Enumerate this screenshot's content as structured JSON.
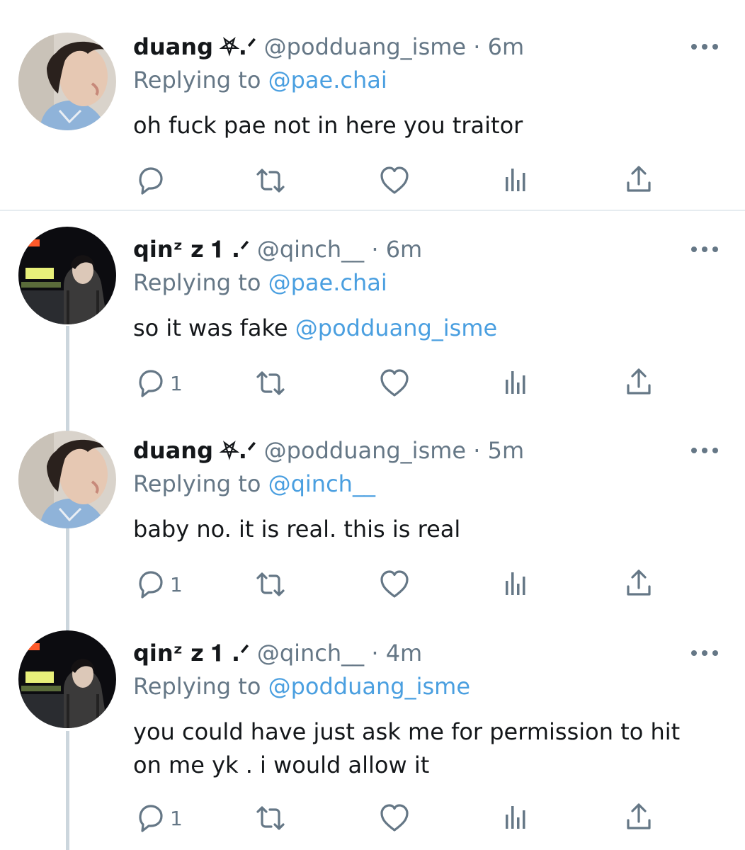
{
  "tweets": [
    {
      "name": "duang",
      "deco": "⛧.ᐟ",
      "handle_time": "@podduang_isme · 6m",
      "replying_prefix": "Replying to ",
      "replying_to": "@pae.chai",
      "text": "oh fuck pae not in here you traitor",
      "text_mention": "",
      "reply_count": ""
    },
    {
      "name": "qinᶻ z",
      "deco": "𝟏 .ᐟ",
      "handle_time": "@qinch__ · 6m",
      "replying_prefix": "Replying to ",
      "replying_to": "@pae.chai",
      "text": "so it was fake ",
      "text_mention": "@podduang_isme",
      "reply_count": "1"
    },
    {
      "name": "duang",
      "deco": "⛧.ᐟ",
      "handle_time": "@podduang_isme · 5m",
      "replying_prefix": "Replying to ",
      "replying_to": "@qinch__",
      "text": "baby no. it is real. this is real",
      "text_mention": "",
      "reply_count": "1"
    },
    {
      "name": "qinᶻ z",
      "deco": "𝟏 .ᐟ",
      "handle_time": "@qinch__ · 4m",
      "replying_prefix": "Replying to ",
      "replying_to": "@podduang_isme",
      "text": "you could have just ask me for permission to hit on me yk . i would allow it",
      "text_mention": "",
      "reply_count": "1"
    }
  ],
  "icons": {
    "reply": "reply-icon",
    "retweet": "retweet-icon",
    "like": "like-icon",
    "analytics": "analytics-icon",
    "share": "share-icon",
    "more": "more-icon"
  },
  "colors": {
    "link": "#4a9fe0",
    "muted": "#657786",
    "text": "#14171a",
    "divider": "#e6ecf0",
    "thread_line": "#ccd6dd"
  }
}
